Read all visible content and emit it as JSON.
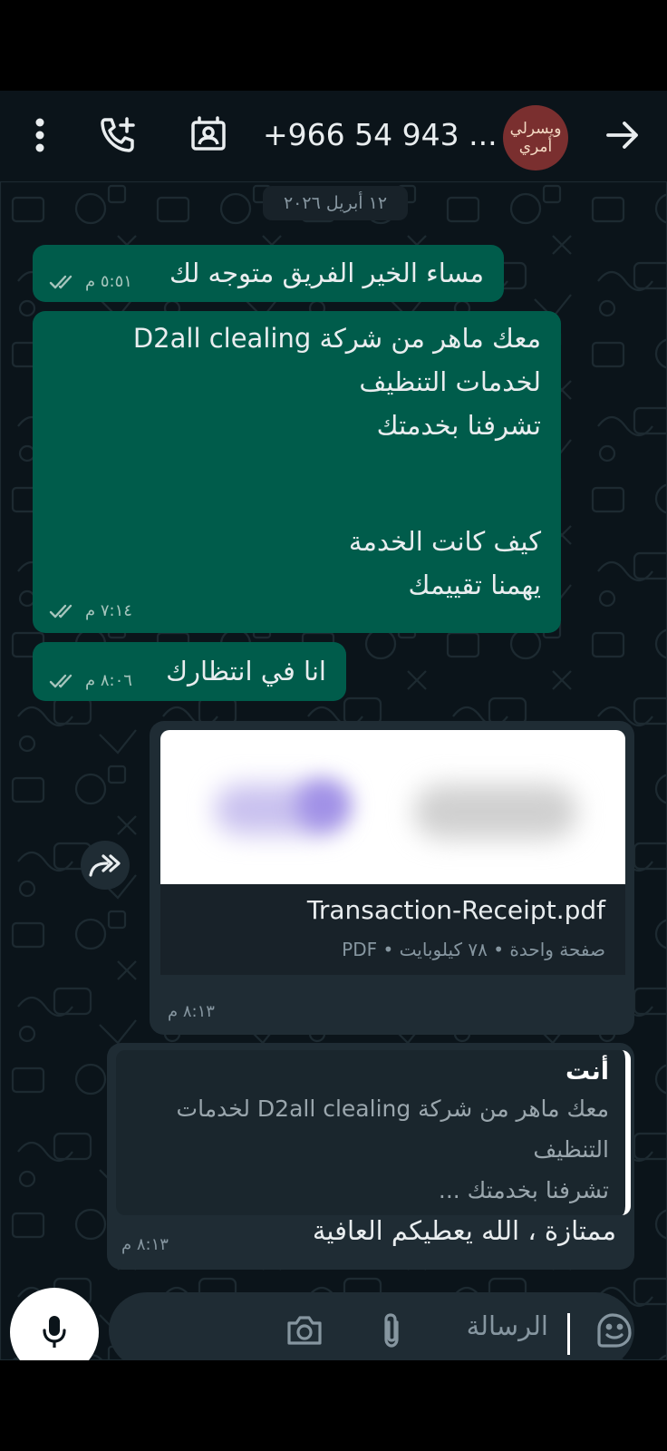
{
  "header": {
    "contact_name": "+966 54 943 ...",
    "avatar_text": "ويسرلي أمري"
  },
  "chat": {
    "date_label": "١٢ أبريل ٢٠٢٦",
    "messages": [
      {
        "lines": [
          "مساء الخير الفريق متوجه لك"
        ],
        "time": "٥:٥١ م"
      },
      {
        "lines": [
          "معك ماهر من شركة D2all clealing",
          "لخدمات التنظيف",
          "تشرفنا بخدمتك",
          "",
          "",
          "كيف كانت الخدمة",
          "يهمنا تقييمك"
        ],
        "time": "٧:١٤ م"
      },
      {
        "lines": [
          "انا في انتظارك"
        ],
        "time": "٨:٠٦ م"
      }
    ],
    "document": {
      "file_name": "Transaction-Receipt.pdf",
      "info": "صفحة واحدة  •  ٧٨ كيلوبايت  •  PDF",
      "time": "٨:١٣ م"
    },
    "reply": {
      "quoted_author": "أنت",
      "quoted_lines": [
        "معك ماهر من شركة D2all clealing لخدمات",
        "التنظيف",
        "تشرفنا بخدمتك ..."
      ],
      "text": "ممتازة ، الله يعطيكم العافية",
      "time": "٨:١٣ م"
    }
  },
  "composer": {
    "placeholder": "الرسالة"
  },
  "icons": {
    "menu": "more-vertical-icon",
    "add_call": "add-call-icon",
    "contact_card": "contact-card-icon",
    "back": "arrow-icon",
    "forward": "forward-icon",
    "camera": "camera-icon",
    "attach": "paperclip-icon",
    "sticker": "sticker-icon",
    "mic": "microphone-icon"
  },
  "colors": {
    "outgoing_bubble": "#005c4b",
    "chat_background": "#0b141a",
    "incoming_bubble": "#1f2c34"
  }
}
